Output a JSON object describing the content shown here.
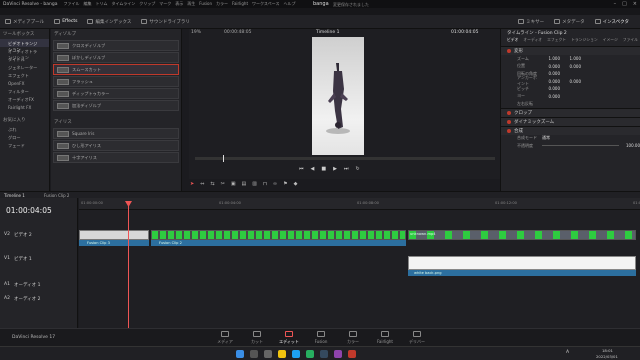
{
  "app": {
    "title": "DaVinci Resolve - banga",
    "project_name": "banga",
    "saved_text": "変更保存されました",
    "version_label": "DaVinci Resolve 17"
  },
  "menu": [
    "DaVinci Resolve",
    "ファイル",
    "編集",
    "トリム",
    "タイムライン",
    "クリップ",
    "マーク",
    "表示",
    "再生",
    "Fusion",
    "カラー",
    "Fairlight",
    "ワークスペース",
    "ヘルプ"
  ],
  "toolbar": {
    "left": [
      {
        "label": "メディアプール"
      },
      {
        "label": "Effects",
        "active": true
      },
      {
        "label": "編集インデックス"
      },
      {
        "label": "サウンドライブラリ"
      }
    ],
    "right": [
      {
        "label": "ミキサー"
      },
      {
        "label": "メタデータ"
      },
      {
        "label": "インスペクタ",
        "active": true
      }
    ]
  },
  "sidebar": {
    "header": "ツールボックス",
    "items": [
      {
        "label": "ビデオトランジション",
        "selected": true
      },
      {
        "label": "オーディオトランジション"
      },
      {
        "label": "タイトル"
      },
      {
        "label": "ジェネレーター"
      },
      {
        "label": "エフェクト"
      },
      {
        "label": "OpenFX"
      },
      {
        "label": "フィルター"
      },
      {
        "label": "オーディオFX"
      },
      {
        "label": "Fairlight FX"
      }
    ],
    "favorites_header": "お気に入り",
    "favorites": [
      "ぶれ",
      "グロー",
      "フェード"
    ]
  },
  "effects": {
    "section": "ディゾルブ",
    "items": [
      {
        "label": "クロスディゾルブ"
      },
      {
        "label": "ぼかしディゾルブ"
      },
      {
        "label": "スムースカット",
        "selected": true
      },
      {
        "label": "フラッシュ"
      },
      {
        "label": "ディップトゥカラー"
      },
      {
        "label": "加法ディゾルブ"
      }
    ],
    "section2": "アイリス",
    "items2": [
      "Square Iris",
      "ひし形アイリス",
      "十字アイリス"
    ]
  },
  "viewer": {
    "zoom": "19%",
    "source_tc": "00:00:48:05",
    "timeline_name": "Timeline 1",
    "timecode": "01:00:04:05"
  },
  "inspector": {
    "title": "タイムライン - Fusion Clip 2",
    "tabs": [
      "ビデオ",
      "オーディオ",
      "エフェクト",
      "トランジション",
      "イメージ",
      "ファイル"
    ],
    "transform_title": "変形",
    "rows": [
      {
        "label": "ズーム",
        "x": "1.000",
        "y": "1.000"
      },
      {
        "label": "位置",
        "x": "0.000",
        "y": "0.000"
      },
      {
        "label": "回転の角度",
        "x": "0.000",
        "y": ""
      },
      {
        "label": "アンカーポイント",
        "x": "0.000",
        "y": "0.000"
      },
      {
        "label": "ピッチ",
        "x": "0.000",
        "y": ""
      },
      {
        "label": "ヨー",
        "x": "0.000",
        "y": ""
      },
      {
        "label": "左右反転",
        "x": "",
        "y": ""
      }
    ],
    "sections": [
      "クロップ",
      "ダイナミックズーム",
      "合成"
    ],
    "composite_mode_label": "合成モード",
    "composite_mode_value": "通常",
    "opacity_label": "不透明度",
    "opacity_value": "100.00"
  },
  "timeline": {
    "tab1": "Timeline 1",
    "tab2": "Fusion Clip 2",
    "timecode": "01:00:04:05",
    "ruler": [
      "01:00:00:00",
      "01:00:04:00",
      "01:00:08:00",
      "01:00:12:00",
      "01:00:16:00"
    ],
    "tracks": [
      {
        "id": "V2",
        "name": "ビデオ 2"
      },
      {
        "id": "V1",
        "name": "ビデオ 1"
      },
      {
        "id": "A1",
        "name": "オーディオ 1"
      },
      {
        "id": "A2",
        "name": "オーディオ 2"
      }
    ],
    "clips": {
      "fusion1": "Fusion Clip 3",
      "fusion2": "Fusion Clip 2",
      "v2b": "unknown.mp4",
      "v1": "white back.png"
    },
    "playhead_fraction": 0.1
  },
  "pages": [
    {
      "label": "メディア"
    },
    {
      "label": "カット"
    },
    {
      "label": "エディット",
      "active": true
    },
    {
      "label": "Fusion"
    },
    {
      "label": "カラー"
    },
    {
      "label": "Fairlight"
    },
    {
      "label": "デリバー"
    }
  ],
  "taskbar": {
    "time": "18:01",
    "date": "2022/03/01",
    "lang": "A"
  },
  "colors": {
    "accent": "#c0392b",
    "clip_blue": "#2c6f9f",
    "clip_green": "#2ecc40"
  }
}
